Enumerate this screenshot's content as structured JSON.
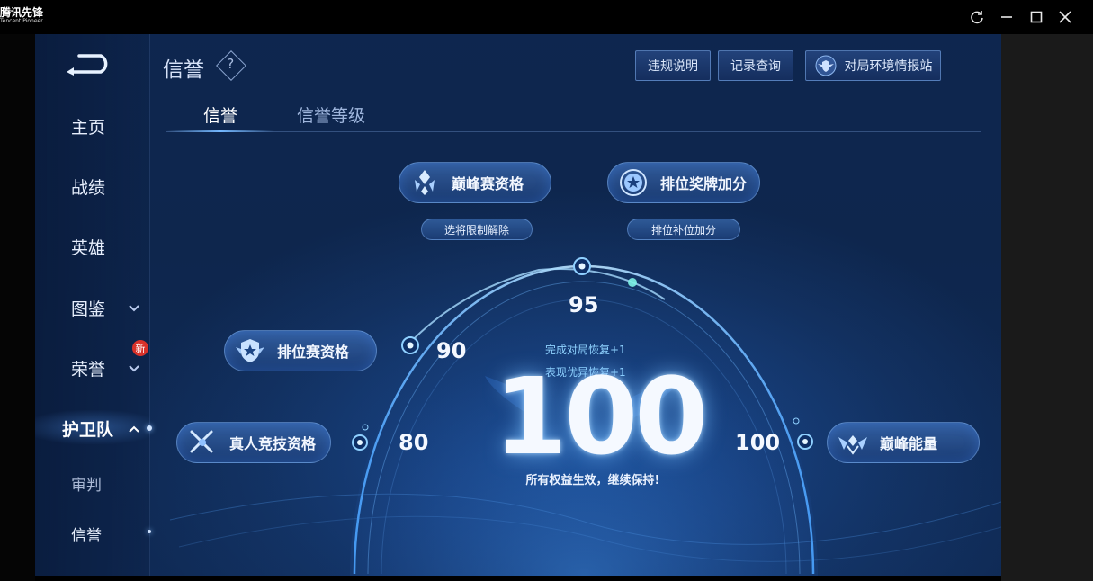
{
  "window": {
    "app_name": "腾讯先锋",
    "app_subtitle": "Tencent Pioneer",
    "controls": [
      "refresh-icon",
      "minimize-icon",
      "maximize-icon",
      "close-icon"
    ]
  },
  "sidebar": {
    "items": [
      {
        "label": "主页"
      },
      {
        "label": "战绩"
      },
      {
        "label": "英雄"
      },
      {
        "label": "图鉴"
      },
      {
        "label": "荣誉",
        "badge": "新"
      },
      {
        "label": "护卫队"
      },
      {
        "label": "审判"
      },
      {
        "label": "信誉"
      }
    ]
  },
  "header": {
    "title": "信誉",
    "buttons": {
      "rules": "违规说明",
      "records": "记录查询",
      "report": "对局环境情报站"
    }
  },
  "tabs": [
    {
      "label": "信誉",
      "active": true
    },
    {
      "label": "信誉等级",
      "active": false
    }
  ],
  "privileges": {
    "peak_match": "巅峰赛资格",
    "hero_unlock": "选将限制解除",
    "rank_medal": "排位奖牌加分",
    "rank_fill": "排位补位加分",
    "ranked_match": "排位赛资格",
    "real_match": "真人竞技资格",
    "peak_energy": "巅峰能量"
  },
  "scale": {
    "marks": [
      "80",
      "90",
      "95",
      "100"
    ],
    "recover_1": "完成对局恢复+1",
    "recover_2": "表现优异恢复+1"
  },
  "score": {
    "value": "100",
    "status": "所有权益生效，继续保持!"
  },
  "colors": {
    "accent": "#74b8ff",
    "background": "#12305f",
    "badge": "#d8322a"
  }
}
